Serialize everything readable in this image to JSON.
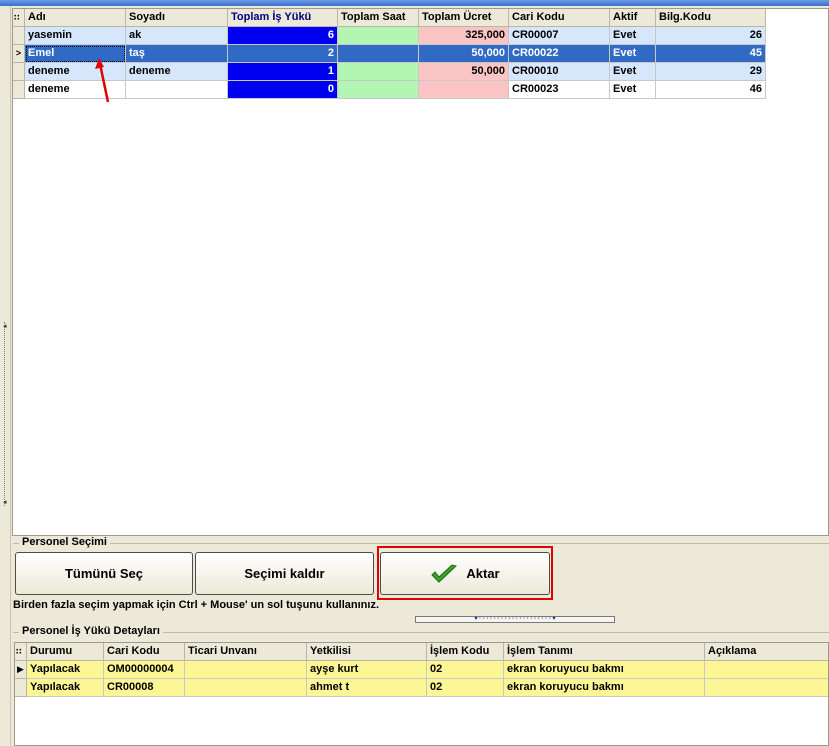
{
  "personel_grid": {
    "columns": [
      "Adı",
      "Soyadı",
      "Toplam İş Yükü",
      "Toplam Saat",
      "Toplam Ücret",
      "Cari Kodu",
      "Aktif",
      "Bilg.Kodu"
    ],
    "rows": [
      {
        "adi": "yasemin",
        "soyadi": "ak",
        "is_yuku": "6",
        "saat": "",
        "ucret": "325,000",
        "cari": "CR00007",
        "aktif": "Evet",
        "bilg": "26"
      },
      {
        "adi": "Emel",
        "soyadi": "taş",
        "is_yuku": "2",
        "saat": "",
        "ucret": "50,000",
        "cari": "CR00022",
        "aktif": "Evet",
        "bilg": "45"
      },
      {
        "adi": "deneme",
        "soyadi": "deneme",
        "is_yuku": "1",
        "saat": "",
        "ucret": "50,000",
        "cari": "CR00010",
        "aktif": "Evet",
        "bilg": "29"
      },
      {
        "adi": "deneme",
        "soyadi": "",
        "is_yuku": "0",
        "saat": "",
        "ucret": "",
        "cari": "CR00023",
        "aktif": "Evet",
        "bilg": "46"
      }
    ]
  },
  "secim": {
    "title": "Personel Seçimi",
    "select_all": "Tümünü Seç",
    "clear": "Seçimi kaldır",
    "transfer": "Aktar",
    "hint": "Birden fazla seçim yapmak için Ctrl + Mouse' un sol tuşunu kullanınız."
  },
  "detay": {
    "title": "Personel İş Yükü Detayları",
    "columns": [
      "Durumu",
      "Cari Kodu",
      "Ticari Unvanı",
      "Yetkilisi",
      "İşlem Kodu",
      "İşlem Tanımı",
      "Açıklama"
    ],
    "rows": [
      {
        "durumu": "Yapılacak",
        "cari": "OM00000004",
        "unvan": "",
        "yetkili": "ayşe kurt",
        "kod": "02",
        "tanim": "ekran koruyucu bakmı",
        "aciklama": ""
      },
      {
        "durumu": "Yapılacak",
        "cari": "CR00008",
        "unvan": "",
        "yetkili": "ahmet t",
        "kod": "02",
        "tanim": "ekran koruyucu bakmı",
        "aciklama": ""
      }
    ]
  },
  "colors": {
    "row_light": "#d6e7fb",
    "row_selected": "#316ac5",
    "workload_cell": "#0000f0",
    "hours_cell": "#b3f5b3",
    "wage_cell": "#fbc4c4",
    "detail_row": "#fcf794",
    "highlight": "#e00000"
  }
}
